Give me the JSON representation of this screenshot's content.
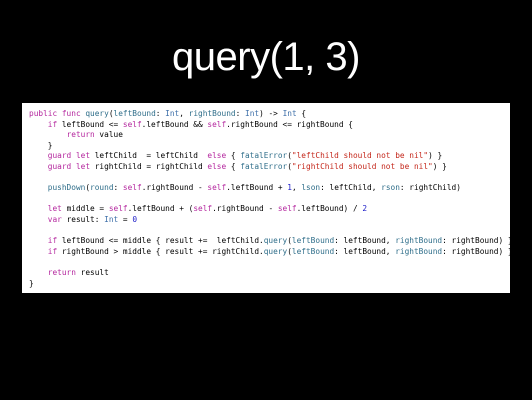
{
  "slide": {
    "title": "query(1, 3)"
  },
  "colors": {
    "background": "#000000",
    "title": "#ffffff",
    "code_background": "#ffffff",
    "keyword": "#b4269e",
    "type": "#3c6ea8",
    "function": "#2f6e8a",
    "string": "#c4271b",
    "number": "#1c1cc9",
    "plain": "#000000"
  },
  "code": {
    "language": "swift",
    "lines": [
      [
        [
          "kw",
          "public func "
        ],
        [
          "fn",
          "query"
        ],
        [
          "plain",
          "("
        ],
        [
          "fn",
          "leftBound"
        ],
        [
          "plain",
          ": "
        ],
        [
          "type",
          "Int"
        ],
        [
          "plain",
          ", "
        ],
        [
          "fn",
          "rightBound"
        ],
        [
          "plain",
          ": "
        ],
        [
          "type",
          "Int"
        ],
        [
          "plain",
          ") -> "
        ],
        [
          "type",
          "Int"
        ],
        [
          "plain",
          " {"
        ]
      ],
      [
        [
          "plain",
          "    "
        ],
        [
          "kw",
          "if"
        ],
        [
          "plain",
          " leftBound <= "
        ],
        [
          "kw",
          "self"
        ],
        [
          "plain",
          ".leftBound && "
        ],
        [
          "kw",
          "self"
        ],
        [
          "plain",
          ".rightBound <= rightBound {"
        ]
      ],
      [
        [
          "plain",
          "        "
        ],
        [
          "kw",
          "return"
        ],
        [
          "plain",
          " value"
        ]
      ],
      [
        [
          "plain",
          "    }"
        ]
      ],
      [
        [
          "plain",
          "    "
        ],
        [
          "kw",
          "guard let"
        ],
        [
          "plain",
          " leftChild  = leftChild  "
        ],
        [
          "kw",
          "else"
        ],
        [
          "plain",
          " { "
        ],
        [
          "fn",
          "fatalError"
        ],
        [
          "plain",
          "("
        ],
        [
          "str",
          "\"leftChild should not be nil\""
        ],
        [
          "plain",
          ") }"
        ]
      ],
      [
        [
          "plain",
          "    "
        ],
        [
          "kw",
          "guard let"
        ],
        [
          "plain",
          " rightChild = rightChild "
        ],
        [
          "kw",
          "else"
        ],
        [
          "plain",
          " { "
        ],
        [
          "fn",
          "fatalError"
        ],
        [
          "plain",
          "("
        ],
        [
          "str",
          "\"rightChild should not be nil\""
        ],
        [
          "plain",
          ") }"
        ]
      ],
      [],
      [
        [
          "plain",
          "    "
        ],
        [
          "fn",
          "pushDown"
        ],
        [
          "plain",
          "("
        ],
        [
          "fn",
          "round"
        ],
        [
          "plain",
          ": "
        ],
        [
          "kw",
          "self"
        ],
        [
          "plain",
          ".rightBound - "
        ],
        [
          "kw",
          "self"
        ],
        [
          "plain",
          ".leftBound + "
        ],
        [
          "num",
          "1"
        ],
        [
          "plain",
          ", "
        ],
        [
          "fn",
          "lson"
        ],
        [
          "plain",
          ": leftChild, "
        ],
        [
          "fn",
          "rson"
        ],
        [
          "plain",
          ": rightChild)"
        ]
      ],
      [],
      [
        [
          "plain",
          "    "
        ],
        [
          "kw",
          "let"
        ],
        [
          "plain",
          " middle = "
        ],
        [
          "kw",
          "self"
        ],
        [
          "plain",
          ".leftBound + ("
        ],
        [
          "kw",
          "self"
        ],
        [
          "plain",
          ".rightBound - "
        ],
        [
          "kw",
          "self"
        ],
        [
          "plain",
          ".leftBound) / "
        ],
        [
          "num",
          "2"
        ]
      ],
      [
        [
          "plain",
          "    "
        ],
        [
          "kw",
          "var"
        ],
        [
          "plain",
          " result: "
        ],
        [
          "type",
          "Int"
        ],
        [
          "plain",
          " = "
        ],
        [
          "num",
          "0"
        ]
      ],
      [],
      [
        [
          "plain",
          "    "
        ],
        [
          "kw",
          "if"
        ],
        [
          "plain",
          " leftBound <= middle { result +=  leftChild."
        ],
        [
          "fn",
          "query"
        ],
        [
          "plain",
          "("
        ],
        [
          "fn",
          "leftBound"
        ],
        [
          "plain",
          ": leftBound, "
        ],
        [
          "fn",
          "rightBound"
        ],
        [
          "plain",
          ": rightBound) }"
        ]
      ],
      [
        [
          "plain",
          "    "
        ],
        [
          "kw",
          "if"
        ],
        [
          "plain",
          " rightBound > middle { result += rightChild."
        ],
        [
          "fn",
          "query"
        ],
        [
          "plain",
          "("
        ],
        [
          "fn",
          "leftBound"
        ],
        [
          "plain",
          ": leftBound, "
        ],
        [
          "fn",
          "rightBound"
        ],
        [
          "plain",
          ": rightBound) }"
        ]
      ],
      [],
      [
        [
          "plain",
          "    "
        ],
        [
          "kw",
          "return"
        ],
        [
          "plain",
          " result"
        ]
      ],
      [
        [
          "plain",
          "}"
        ]
      ]
    ]
  }
}
